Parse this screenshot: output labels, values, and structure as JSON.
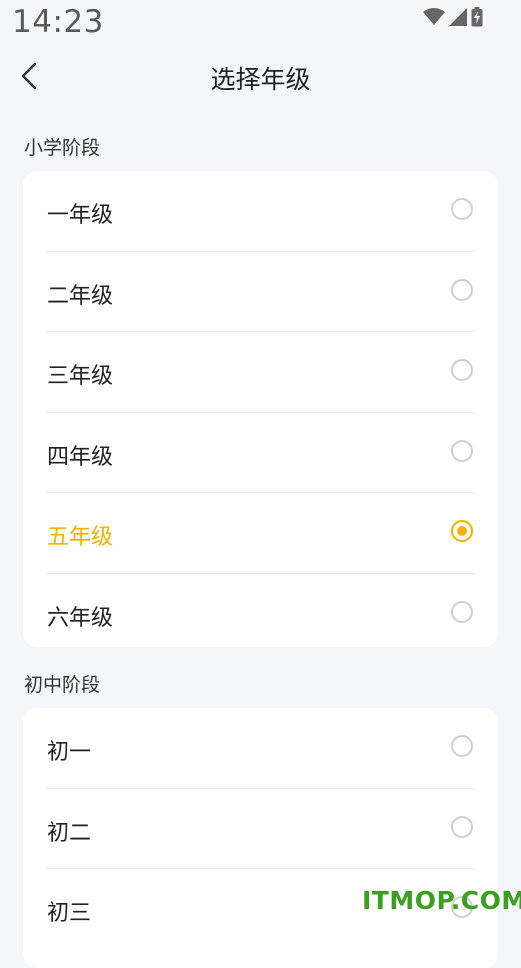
{
  "status_bar": {
    "time": "14:23"
  },
  "nav": {
    "title": "选择年级",
    "back_icon": "chevron-left-icon"
  },
  "colors": {
    "accent": "#f6b000",
    "background": "#f5f6f8",
    "watermark": "#3aa01e"
  },
  "sections": [
    {
      "title": "小学阶段",
      "items": [
        {
          "label": "一年级",
          "selected": false
        },
        {
          "label": "二年级",
          "selected": false
        },
        {
          "label": "三年级",
          "selected": false
        },
        {
          "label": "四年级",
          "selected": false
        },
        {
          "label": "五年级",
          "selected": true
        },
        {
          "label": "六年级",
          "selected": false
        }
      ]
    },
    {
      "title": "初中阶段",
      "items": [
        {
          "label": "初一",
          "selected": false
        },
        {
          "label": "初二",
          "selected": false
        },
        {
          "label": "初三",
          "selected": false
        }
      ]
    }
  ],
  "watermark": "ITMOP.COM"
}
